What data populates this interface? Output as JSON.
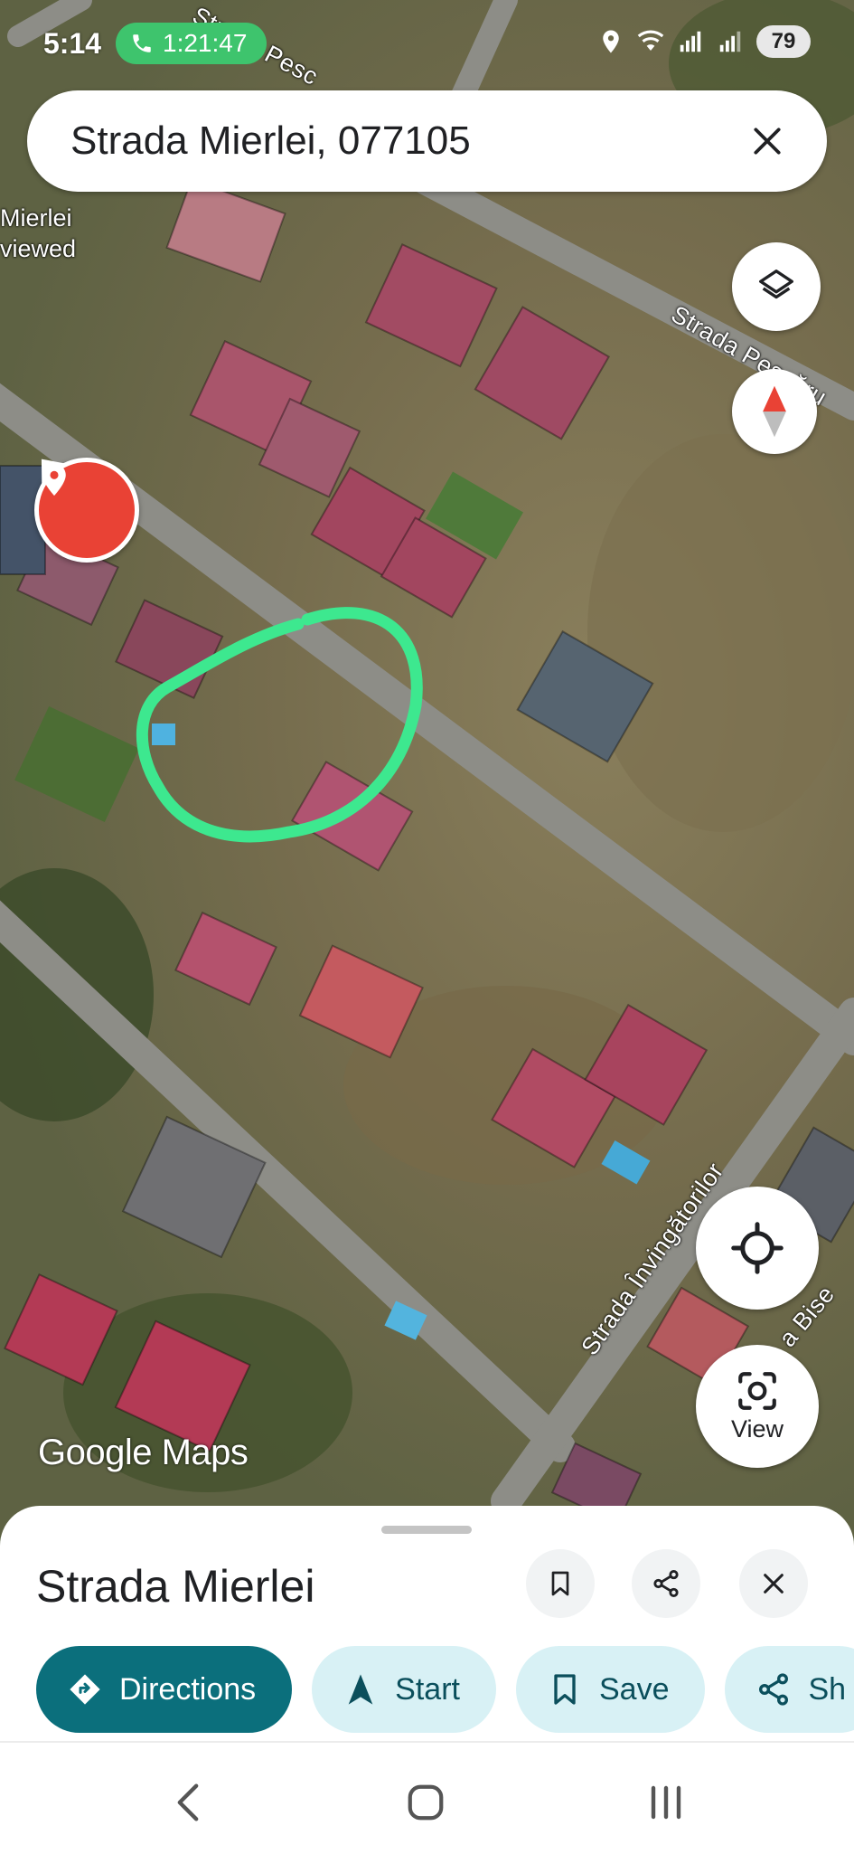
{
  "status_bar": {
    "time": "5:14",
    "call_duration": "1:21:47",
    "battery": "79",
    "icons": [
      "location-icon",
      "wifi-icon",
      "signal-icon",
      "signal-icon-2"
    ]
  },
  "search": {
    "query": "Strada Mierlei, 077105"
  },
  "map": {
    "recent_label_line1": "Mierlei",
    "recent_label_line2": "viewed",
    "street_labels": [
      "Strada Pesc",
      "Strada Pescăru",
      "Strada Învingătorilor",
      "a Bise"
    ],
    "watermark": "Google Maps",
    "pin_color": "#e94235",
    "highlight_color": "#3de88f"
  },
  "controls": {
    "view_label": "View"
  },
  "sheet": {
    "title": "Strada Mierlei",
    "actions": [
      {
        "label": "Directions"
      },
      {
        "label": "Start"
      },
      {
        "label": "Save"
      },
      {
        "label": "Sh"
      }
    ]
  },
  "colors": {
    "primary": "#0b6f7c",
    "chip_bg": "#d8f1f5",
    "call_green": "#3ec46d"
  }
}
